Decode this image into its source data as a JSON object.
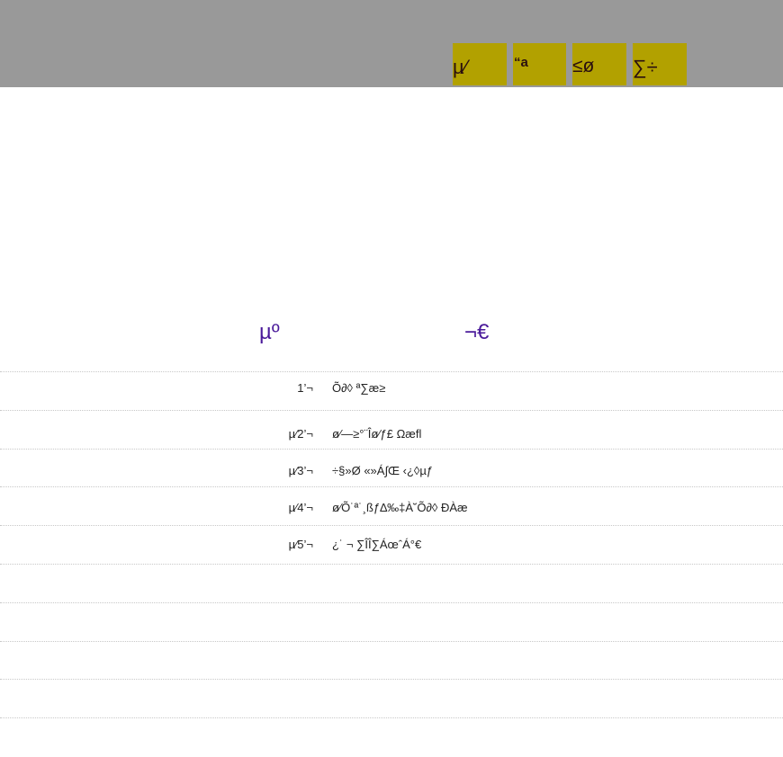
{
  "toolbar": {
    "tabs": [
      {
        "label": "µ⁄"
      },
      {
        "label": "“a"
      },
      {
        "label": "≤ø"
      },
      {
        "label": "∑÷"
      }
    ]
  },
  "table": {
    "headers": [
      "µº",
      "¬€"
    ],
    "rows": [
      {
        "num": "1’¬",
        "text": "Õ∂◊ ª∑æ≥"
      },
      {
        "num": "µ⁄2’¬",
        "text": "ø⁄—≥°¨Îø⁄ƒ£ Ωæfl"
      },
      {
        "num": "µ⁄3’¬",
        "text": "÷§»Ø «»Á∫Œ ‹¿◊µƒ"
      },
      {
        "num": "µ⁄4’¬",
        "text": "ø⁄Õ˙ª˙¸ßƒ∆‰‡À˘Õ∂◊ ÐÀæ"
      },
      {
        "num": "µ⁄5’¬",
        "text": "¿˙ ¬ ∑ÎÎ∑ÁœˆÁ°€"
      }
    ]
  }
}
